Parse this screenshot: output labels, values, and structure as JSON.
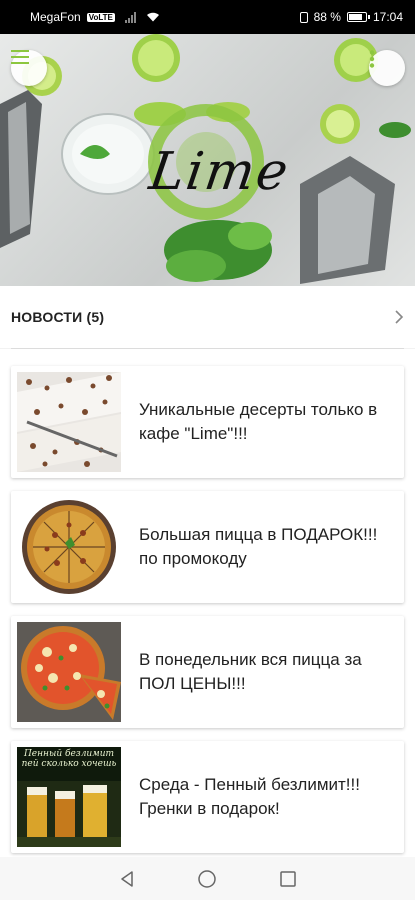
{
  "status_bar": {
    "carrier": "MegaFon",
    "volte": "VoLTE",
    "battery_text": "88 %",
    "battery_level": 0.88,
    "time": "17:04"
  },
  "hero": {
    "logo_text": "Lime",
    "menu_icon": "hamburger-icon",
    "more_icon": "more-vertical-icon",
    "accent_color": "#8cc63f"
  },
  "news": {
    "title": "НОВОСТИ (5)",
    "items": [
      {
        "text": "Уникальные десерты только в кафе \"Lime\"!!!",
        "image": "desserts"
      },
      {
        "text": "Большая пицца в ПОДАРОК!!! по промокоду",
        "image": "pizza-whole"
      },
      {
        "text": "В понедельник вся пицца за ПОЛ ЦЕНЫ!!!",
        "image": "pizza-slices"
      },
      {
        "text": "Среда - Пенный безлимит!!! Гренки в подарок!",
        "image": "beer-poster",
        "image_caption": "Пенный безлимит пей сколько хочешь"
      }
    ]
  },
  "nav": {
    "back": "back-icon",
    "home": "home-icon",
    "recents": "recents-icon"
  }
}
